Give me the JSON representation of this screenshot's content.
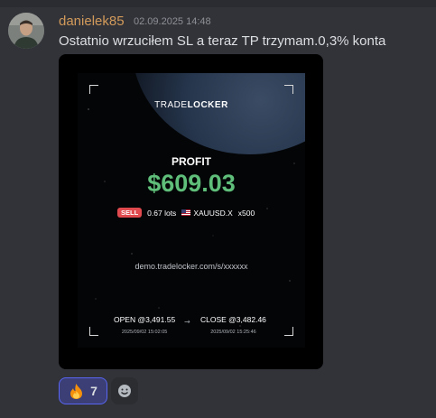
{
  "message": {
    "username": "danielek85",
    "timestamp": "02.09.2025 14:48",
    "text": "Ostatnio wrzuciłem SL a teraz TP trzymam.0,3% konta"
  },
  "card": {
    "brand_part1": "TRADE",
    "brand_part2": "LOCKER",
    "profit_label": "PROFIT",
    "profit_value": "$609.03",
    "side": "SELL",
    "lots": "0.67 lots",
    "pair": "XAUUSD.X",
    "leverage": "x500",
    "link": "demo.tradelocker.com/s/xxxxxx",
    "open_label": "OPEN @3,491.55",
    "open_time": "2025/09/02 15:02:05",
    "arrow": "→",
    "close_label": "CLOSE @3,482.46",
    "close_time": "2025/09/02 15:25:46"
  },
  "reactions": [
    {
      "emoji": "fire",
      "count": "7",
      "glyph": "🔥"
    },
    {
      "emoji": "add-reaction-icon",
      "glyph": ""
    }
  ],
  "colors": {
    "background": "#323339",
    "username": "#d29a5a",
    "profit": "#5fbf7a",
    "sell_badge": "#e0494e",
    "reaction_active_border": "#5865f2"
  }
}
